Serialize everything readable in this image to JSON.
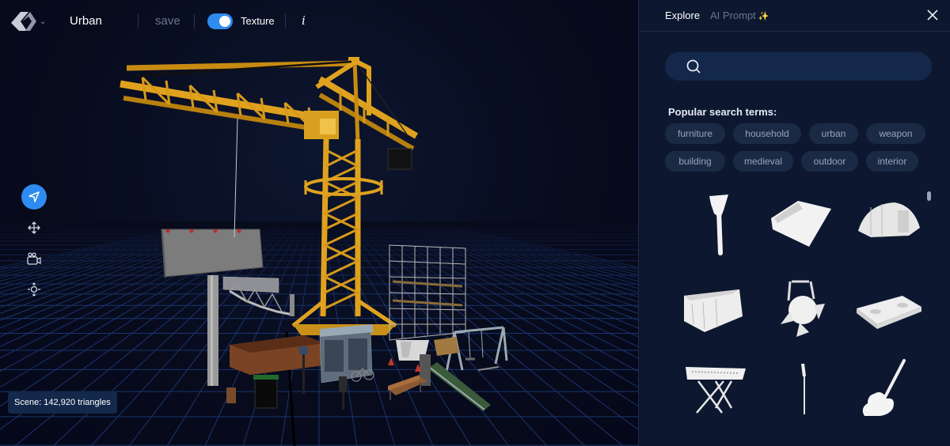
{
  "header": {
    "project_name": "Urban",
    "save_label": "save",
    "texture_label": "Texture",
    "texture_enabled": true,
    "info_label": "i"
  },
  "tools": [
    {
      "name": "select",
      "icon": "navigation-arrow-icon",
      "active": true
    },
    {
      "name": "move",
      "icon": "move-arrows-icon",
      "active": false
    },
    {
      "name": "camera",
      "icon": "camera-icon",
      "active": false
    },
    {
      "name": "focus",
      "icon": "zoom-focus-icon",
      "active": false
    }
  ],
  "scene": {
    "stats": "Scene: 142,920 triangles"
  },
  "panel": {
    "tabs": [
      {
        "label": "Explore",
        "active": true
      },
      {
        "label": "AI Prompt",
        "active": false
      }
    ],
    "ai_spark": "✨",
    "search": {
      "placeholder": "",
      "value": ""
    },
    "popular_title": "Popular search terms:",
    "popular_terms": [
      "furniture",
      "household",
      "urban",
      "weapon",
      "building",
      "medieval",
      "outdoor",
      "interior"
    ],
    "results": [
      {
        "icon": "axe-icon"
      },
      {
        "icon": "sheet-icon"
      },
      {
        "icon": "tent-icon"
      },
      {
        "icon": "planter-icon"
      },
      {
        "icon": "spotlight-icon"
      },
      {
        "icon": "dj-table-icon"
      },
      {
        "icon": "keyboard-icon"
      },
      {
        "icon": "mic-stand-icon"
      },
      {
        "icon": "guitar-icon"
      }
    ]
  },
  "colors": {
    "accent": "#2e8cf0",
    "crane": "#e0a21e",
    "panel_bg": "#0d1830",
    "viewport_bg": "#070b1c"
  }
}
